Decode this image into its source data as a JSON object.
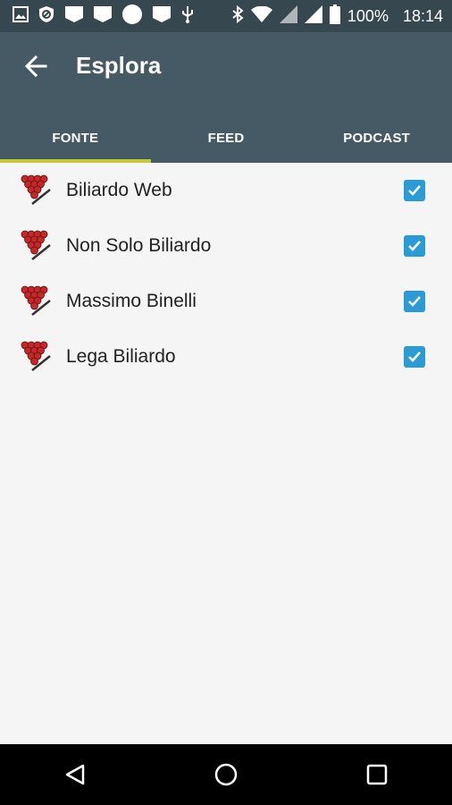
{
  "status_bar": {
    "battery": "100%",
    "time": "18:14",
    "left_icons": [
      "image-icon",
      "blocked-icon",
      "notification-icon",
      "notification-icon",
      "circle-icon",
      "notification-icon",
      "usb-icon"
    ],
    "right_icons": [
      "bluetooth-icon",
      "wifi-icon",
      "signal-icon",
      "signal-icon",
      "battery-icon"
    ]
  },
  "app_bar": {
    "title": "Esplora",
    "back_icon": "arrow-back-icon"
  },
  "tabs": [
    {
      "label": "FONTE",
      "active": true
    },
    {
      "label": "FEED",
      "active": false
    },
    {
      "label": "PODCAST",
      "active": false
    }
  ],
  "sources": [
    {
      "label": "Biliardo Web",
      "checked": true,
      "icon": "billiard-rack-icon"
    },
    {
      "label": "Non Solo Biliardo",
      "checked": true,
      "icon": "billiard-rack-icon"
    },
    {
      "label": "Massimo Binelli",
      "checked": true,
      "icon": "billiard-rack-icon"
    },
    {
      "label": "Lega Biliardo",
      "checked": true,
      "icon": "billiard-rack-icon"
    }
  ],
  "nav_bar": {
    "buttons": [
      "back-triangle-icon",
      "home-circle-icon",
      "recents-square-icon"
    ]
  },
  "colors": {
    "status_bar": "#37474f",
    "app_bar": "#455a64",
    "tab_indicator": "#c0ca33",
    "checkbox": "#2b9bd6",
    "background": "#f5f5f5"
  }
}
